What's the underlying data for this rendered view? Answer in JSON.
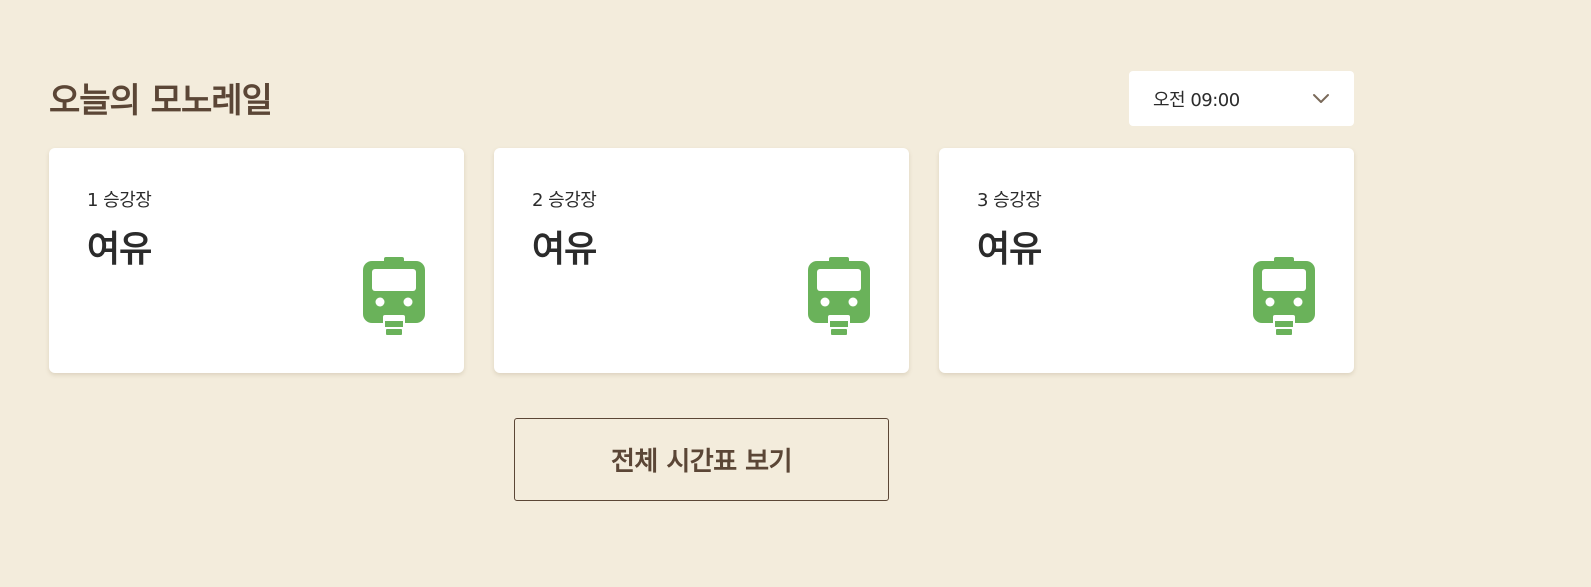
{
  "header": {
    "title": "오늘의 모노레일"
  },
  "time_select": {
    "value": "오전 09:00",
    "icon": "chevron-down-icon"
  },
  "platforms": [
    {
      "label": "1 승강장",
      "status": "여유",
      "icon": "train-icon"
    },
    {
      "label": "2 승강장",
      "status": "여유",
      "icon": "train-icon"
    },
    {
      "label": "3 승강장",
      "status": "여유",
      "icon": "train-icon"
    }
  ],
  "actions": {
    "timetable_label": "전체 시간표 보기"
  },
  "colors": {
    "background": "#f3ecdc",
    "title_brown": "#5b4636",
    "card": "#ffffff",
    "train_green": "#6ab25a",
    "text_dark": "#2b2b2b"
  }
}
